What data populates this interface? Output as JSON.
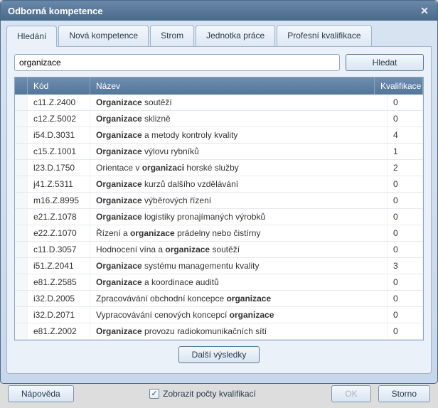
{
  "dialog": {
    "title": "Odborná kompetence"
  },
  "tabs": [
    {
      "label": "Hledání",
      "active": true
    },
    {
      "label": "Nová kompetence",
      "active": false
    },
    {
      "label": "Strom",
      "active": false
    },
    {
      "label": "Jednotka práce",
      "active": false
    },
    {
      "label": "Profesní kvalifikace",
      "active": false
    }
  ],
  "search": {
    "value": "organizace",
    "button": "Hledat"
  },
  "table": {
    "headers": {
      "code": "Kód",
      "name": "Název",
      "qual": "Kvalifikace"
    },
    "rows": [
      {
        "code": "c11.Z.2400",
        "name_parts": [
          [
            "b",
            "Organizace"
          ],
          [
            "",
            " soutěží"
          ]
        ],
        "qual": "0"
      },
      {
        "code": "c12.Z.5002",
        "name_parts": [
          [
            "b",
            "Organizace"
          ],
          [
            "",
            " sklizně"
          ]
        ],
        "qual": "0"
      },
      {
        "code": "i54.D.3031",
        "name_parts": [
          [
            "b",
            "Organizace"
          ],
          [
            "",
            " a metody kontroly kvality"
          ]
        ],
        "qual": "4"
      },
      {
        "code": "c15.Z.1001",
        "name_parts": [
          [
            "b",
            "Organizace"
          ],
          [
            "",
            " výlovu rybníků"
          ]
        ],
        "qual": "1"
      },
      {
        "code": "l23.D.1750",
        "name_parts": [
          [
            "",
            "Orientace v "
          ],
          [
            "b",
            "organizaci"
          ],
          [
            "",
            " horské služby"
          ]
        ],
        "qual": "2"
      },
      {
        "code": "j41.Z.5311",
        "name_parts": [
          [
            "b",
            "Organizace"
          ],
          [
            "",
            " kurzů dalšího vzdělávání"
          ]
        ],
        "qual": "0"
      },
      {
        "code": "m16.Z.8995",
        "name_parts": [
          [
            "b",
            "Organizace"
          ],
          [
            "",
            " výběrových řízení"
          ]
        ],
        "qual": "0"
      },
      {
        "code": "e21.Z.1078",
        "name_parts": [
          [
            "b",
            "Organizace"
          ],
          [
            "",
            " logistiky pronajímaných výrobků"
          ]
        ],
        "qual": "0"
      },
      {
        "code": "e22.Z.1070",
        "name_parts": [
          [
            "",
            "Řízení a "
          ],
          [
            "b",
            "organizace"
          ],
          [
            "",
            " prádelny nebo čistírny"
          ]
        ],
        "qual": "0"
      },
      {
        "code": "c11.D.3057",
        "name_parts": [
          [
            "",
            "Hodnocení vína a "
          ],
          [
            "b",
            "organizace"
          ],
          [
            "",
            " soutěží"
          ]
        ],
        "qual": "0"
      },
      {
        "code": "i51.Z.2041",
        "name_parts": [
          [
            "b",
            "Organizace"
          ],
          [
            "",
            " systému managementu kvality"
          ]
        ],
        "qual": "3"
      },
      {
        "code": "e81.Z.2585",
        "name_parts": [
          [
            "b",
            "Organizace"
          ],
          [
            "",
            " a koordinace auditů"
          ]
        ],
        "qual": "0"
      },
      {
        "code": "i32.D.2005",
        "name_parts": [
          [
            "",
            "Zpracovávání obchodní koncepce "
          ],
          [
            "b",
            "organizace"
          ]
        ],
        "qual": "0"
      },
      {
        "code": "i32.D.2071",
        "name_parts": [
          [
            "",
            "Vypracovávání cenových koncepcí "
          ],
          [
            "b",
            "organizace"
          ]
        ],
        "qual": "0"
      },
      {
        "code": "e81.Z.2002",
        "name_parts": [
          [
            "b",
            "Organizace"
          ],
          [
            "",
            " provozu radiokomunikačních sítí"
          ]
        ],
        "qual": "0"
      }
    ],
    "more_button": "Další výsledky"
  },
  "footer": {
    "help": "Nápověda",
    "show_counts": "Zobrazit počty kvalifikací",
    "show_counts_checked": true,
    "ok": "OK",
    "cancel": "Storno"
  }
}
